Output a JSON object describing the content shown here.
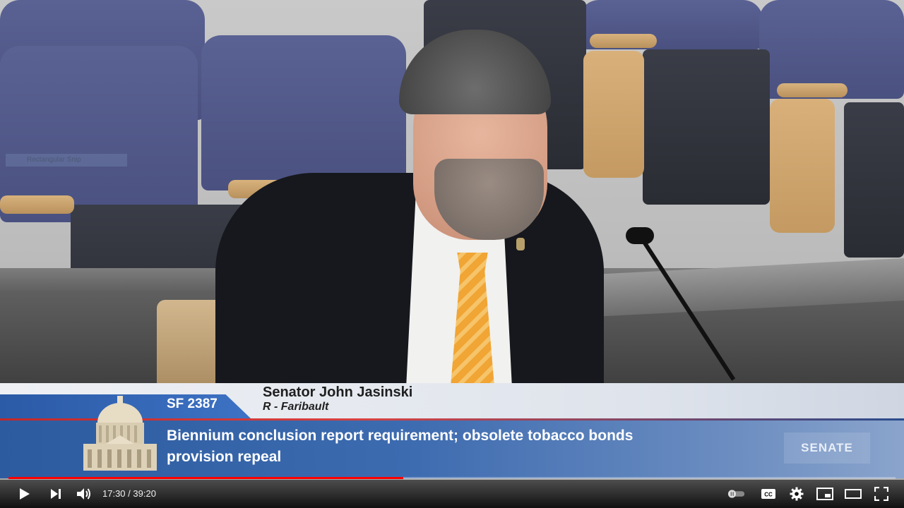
{
  "lower_third": {
    "bill_number": "SF 2387",
    "speaker_name": "Senator John Jasinski",
    "speaker_party_district": "R - Faribault",
    "description": "Biennium conclusion report requirement; obsolete tobacco bonds provision repeal",
    "channel_logo_text": "SENATE"
  },
  "overlay": {
    "ghost_label": "Rectangular Snip"
  },
  "player": {
    "current_time": "17:30",
    "time_separator": "/",
    "duration": "39:20",
    "progress_fraction": 0.445,
    "accent_color": "#ff0000",
    "controls": {
      "play": "play-icon",
      "next": "next-icon",
      "volume": "volume-icon",
      "autoplay": "autoplay-toggle-icon",
      "captions": "captions-icon",
      "settings": "gear-icon",
      "miniplayer": "miniplayer-icon",
      "theater": "theater-mode-icon",
      "fullscreen": "fullscreen-icon"
    }
  }
}
